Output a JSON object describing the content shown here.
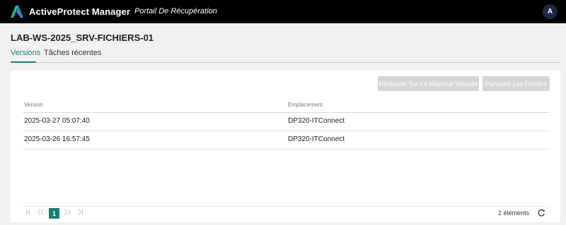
{
  "header": {
    "brand": "ActiveProtect Manager",
    "subtitle": "Portail De Récupération",
    "avatar_letter": "A",
    "logo_icon": "activeprotect-logo-icon",
    "accent_color": "#1a7f72"
  },
  "page": {
    "title": "LAB-WS-2025_SRV-FICHIERS-01"
  },
  "tabs": [
    {
      "label": "Versions",
      "active": true
    },
    {
      "label": "Tâches récentes",
      "active": false
    }
  ],
  "toolbar": {
    "restore_label": "Restaurer Sur La Machine Virtuelle",
    "browse_label": "Parcourir Les Fichiers"
  },
  "table": {
    "columns": [
      "Version",
      "Emplacement"
    ],
    "rows": [
      {
        "version": "2025-03-27 05:07:40",
        "location": "DP320-ITConnect"
      },
      {
        "version": "2025-03-26 16:57:45",
        "location": "DP320-ITConnect"
      }
    ]
  },
  "pagination": {
    "first_icon": "first-page-icon",
    "prev_icon": "prev-page-icon",
    "current_page": "1",
    "next_icon": "next-page-icon",
    "last_icon": "last-page-icon",
    "count_label": "2 éléments",
    "refresh_icon": "refresh-icon"
  }
}
